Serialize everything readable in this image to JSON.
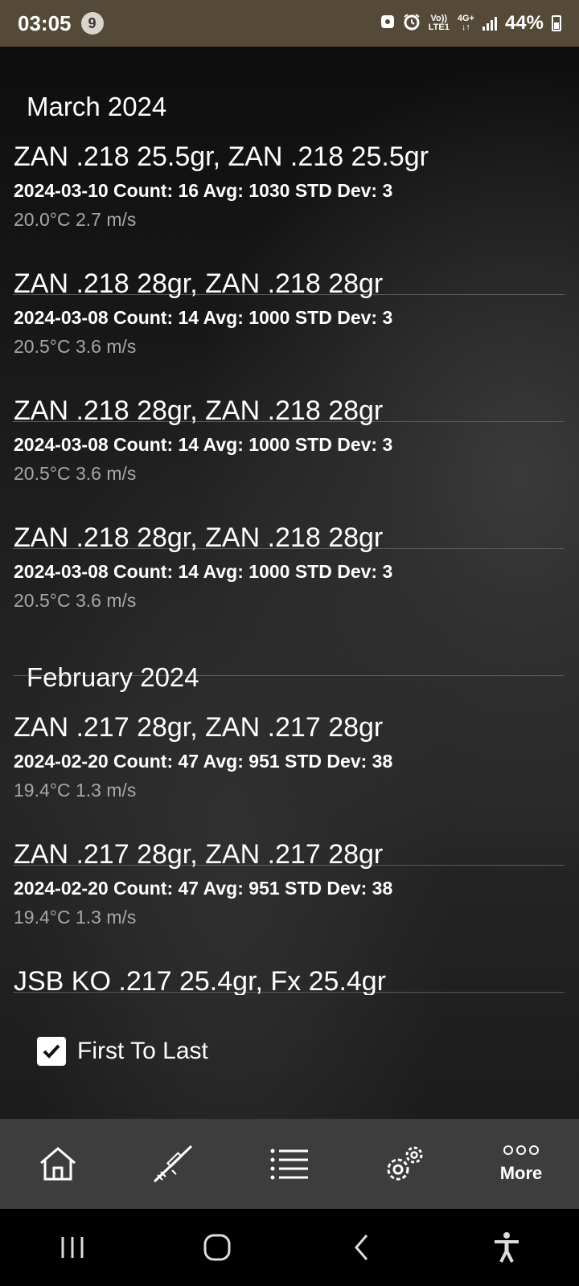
{
  "status_bar": {
    "time": "03:05",
    "notification_count": "9",
    "network_top": "Vo))",
    "network_bottom": "LTE1",
    "network_type": "4G+",
    "battery": "44%"
  },
  "months": [
    {
      "label": "March 2024",
      "sessions": [
        {
          "title": "ZAN .218 25.5gr, ZAN .218 25.5gr",
          "stats": "2024-03-10 Count: 16 Avg: 1030 STD Dev: 3",
          "env": "20.0°C 2.7 m/s"
        },
        {
          "title": "ZAN .218 28gr, ZAN .218 28gr",
          "stats": "2024-03-08 Count: 14 Avg: 1000 STD Dev: 3",
          "env": "20.5°C 3.6 m/s"
        },
        {
          "title": "ZAN .218 28gr, ZAN .218 28gr",
          "stats": "2024-03-08 Count: 14 Avg: 1000 STD Dev: 3",
          "env": "20.5°C 3.6 m/s"
        },
        {
          "title": "ZAN .218 28gr, ZAN .218 28gr",
          "stats": "2024-03-08 Count: 14 Avg: 1000 STD Dev: 3",
          "env": "20.5°C 3.6 m/s"
        }
      ]
    },
    {
      "label": "February 2024",
      "sessions": [
        {
          "title": "ZAN .217 28gr, ZAN .217 28gr",
          "stats": "2024-02-20 Count: 47 Avg: 951 STD Dev: 38",
          "env": "19.4°C 1.3 m/s"
        },
        {
          "title": "ZAN .217 28gr, ZAN .217 28gr",
          "stats": "2024-02-20 Count: 47 Avg: 951 STD Dev: 38",
          "env": "19.4°C 1.3 m/s"
        },
        {
          "title": "JSB KO .217 25.4gr, Fx 25.4gr",
          "stats": "",
          "env": ""
        }
      ]
    }
  ],
  "sort_option": {
    "label": "First To Last",
    "checked": true
  },
  "bottom_nav": {
    "items": [
      {
        "icon": "home-icon"
      },
      {
        "icon": "rifle-icon"
      },
      {
        "icon": "list-icon"
      },
      {
        "icon": "settings-icon"
      },
      {
        "icon": "more-icon",
        "label": "More"
      }
    ]
  },
  "system_nav": {
    "items": [
      {
        "icon": "recent-apps-icon"
      },
      {
        "icon": "home-circle-icon"
      },
      {
        "icon": "back-icon"
      },
      {
        "icon": "accessibility-icon"
      }
    ]
  }
}
